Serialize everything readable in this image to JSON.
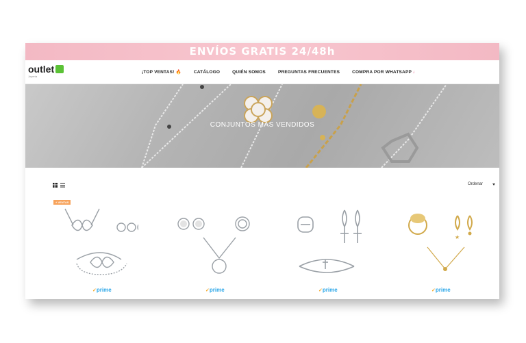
{
  "promo_banner": {
    "text": "ENVÍOS GRATIS 24/48h"
  },
  "logo": {
    "text": "outlet",
    "subtext": "Joyería"
  },
  "nav": {
    "items": [
      {
        "label": "¡TOP VENTAS! 🔥"
      },
      {
        "label": "CATÁLOGO"
      },
      {
        "label": "QUIÉN SOMOS"
      },
      {
        "label": "PREGUNTAS FRECUENTES"
      },
      {
        "label": "COMPRA POR WHATSAPP"
      }
    ]
  },
  "hero": {
    "title": "CONJUNTOS MÁS VENDIDOS"
  },
  "toolbar": {
    "sort_label": "Ordenar"
  },
  "products": [
    {
      "badge": "+ VENTAS",
      "prime": "prime"
    },
    {
      "prime": "prime"
    },
    {
      "prime": "prime"
    },
    {
      "prime": "prime"
    }
  ],
  "colors": {
    "promo": "#f8c6cf",
    "prime": "#2aa6e8",
    "badge": "#f7a35c",
    "logo_badge": "#5bc236"
  }
}
